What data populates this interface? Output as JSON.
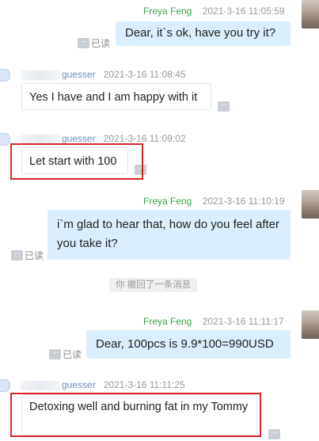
{
  "messages": [
    {
      "sender": "Freya Feng",
      "time": "2021-3-16 11:05:59",
      "text": "Dear, it`s ok, have you try it?",
      "status": "已读"
    },
    {
      "sender": "guesser",
      "time": "2021-3-16 11:08:45",
      "text": "Yes I have and I am happy with it"
    },
    {
      "sender": "guesser",
      "time": "2021-3-16 11:09:02",
      "text": "Let start with 100"
    },
    {
      "sender": "Freya Feng",
      "time": "2021-3-16 11:10:19",
      "text": "i`m glad to hear that, how do you feel after you take it?",
      "status": "已读"
    },
    {
      "sender": "Freya Feng",
      "time": "2021-3-16 11:11:17",
      "text": "Dear, 100pcs is 9.9*100=990USD",
      "status": "已读"
    },
    {
      "sender": "guesser",
      "time": "2021-3-16 11:11:25",
      "text": "Detoxing well and burning fat in my Tommy"
    }
  ],
  "recall_notice": "你 撤回了一条消息",
  "more_button_glyph": "···",
  "colors": {
    "self_bubble": "#dbeeff",
    "highlight": "#d6262b",
    "self_name": "#3aa34a",
    "other_name": "#6b8fb7"
  }
}
